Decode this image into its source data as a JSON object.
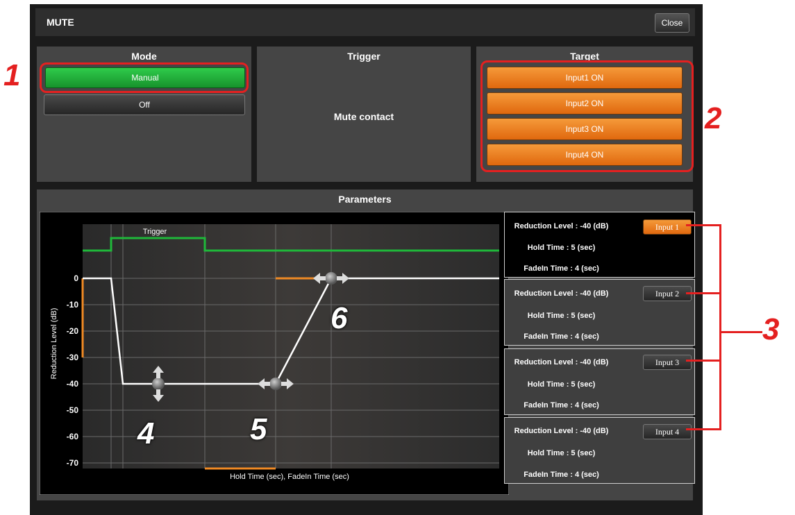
{
  "window": {
    "title": "MUTE",
    "close_label": "Close"
  },
  "mode": {
    "title": "Mode",
    "options": [
      "Manual",
      "Off"
    ],
    "selected": "Manual"
  },
  "trigger": {
    "title": "Trigger",
    "value": "Mute contact"
  },
  "target": {
    "title": "Target",
    "inputs": [
      "Input1 ON",
      "Input2 ON",
      "Input3 ON",
      "Input4 ON"
    ]
  },
  "parameters": {
    "title": "Parameters",
    "chart": {
      "trigger_label": "Trigger",
      "ylabel": "Reduction Level (dB)",
      "xlabel": "Hold Time (sec),  FadeIn Time (sec)",
      "yticks": [
        "0",
        "-10",
        "-20",
        "-30",
        "-40",
        "-50",
        "-60",
        "-70"
      ]
    },
    "inputs": [
      {
        "button": "Input 1",
        "reduction": "Reduction Level : -40 (dB)",
        "hold": "Hold Time : 5 (sec)",
        "fadein": "FadeIn Time : 4 (sec)",
        "selected": true
      },
      {
        "button": "Input 2",
        "reduction": "Reduction Level : -40 (dB)",
        "hold": "Hold Time : 5 (sec)",
        "fadein": "FadeIn Time : 4 (sec)",
        "selected": false
      },
      {
        "button": "Input 3",
        "reduction": "Reduction Level : -40 (dB)",
        "hold": "Hold Time : 5 (sec)",
        "fadein": "FadeIn Time : 4 (sec)",
        "selected": false
      },
      {
        "button": "Input 4",
        "reduction": "Reduction Level : -40 (dB)",
        "hold": "Hold Time : 5 (sec)",
        "fadein": "FadeIn Time : 4 (sec)",
        "selected": false
      }
    ]
  },
  "callouts": [
    "1",
    "2",
    "3",
    "4",
    "5",
    "6"
  ],
  "colors": {
    "green": "#1fb83a",
    "orange": "#f08a24",
    "annotation": "#e42020"
  }
}
